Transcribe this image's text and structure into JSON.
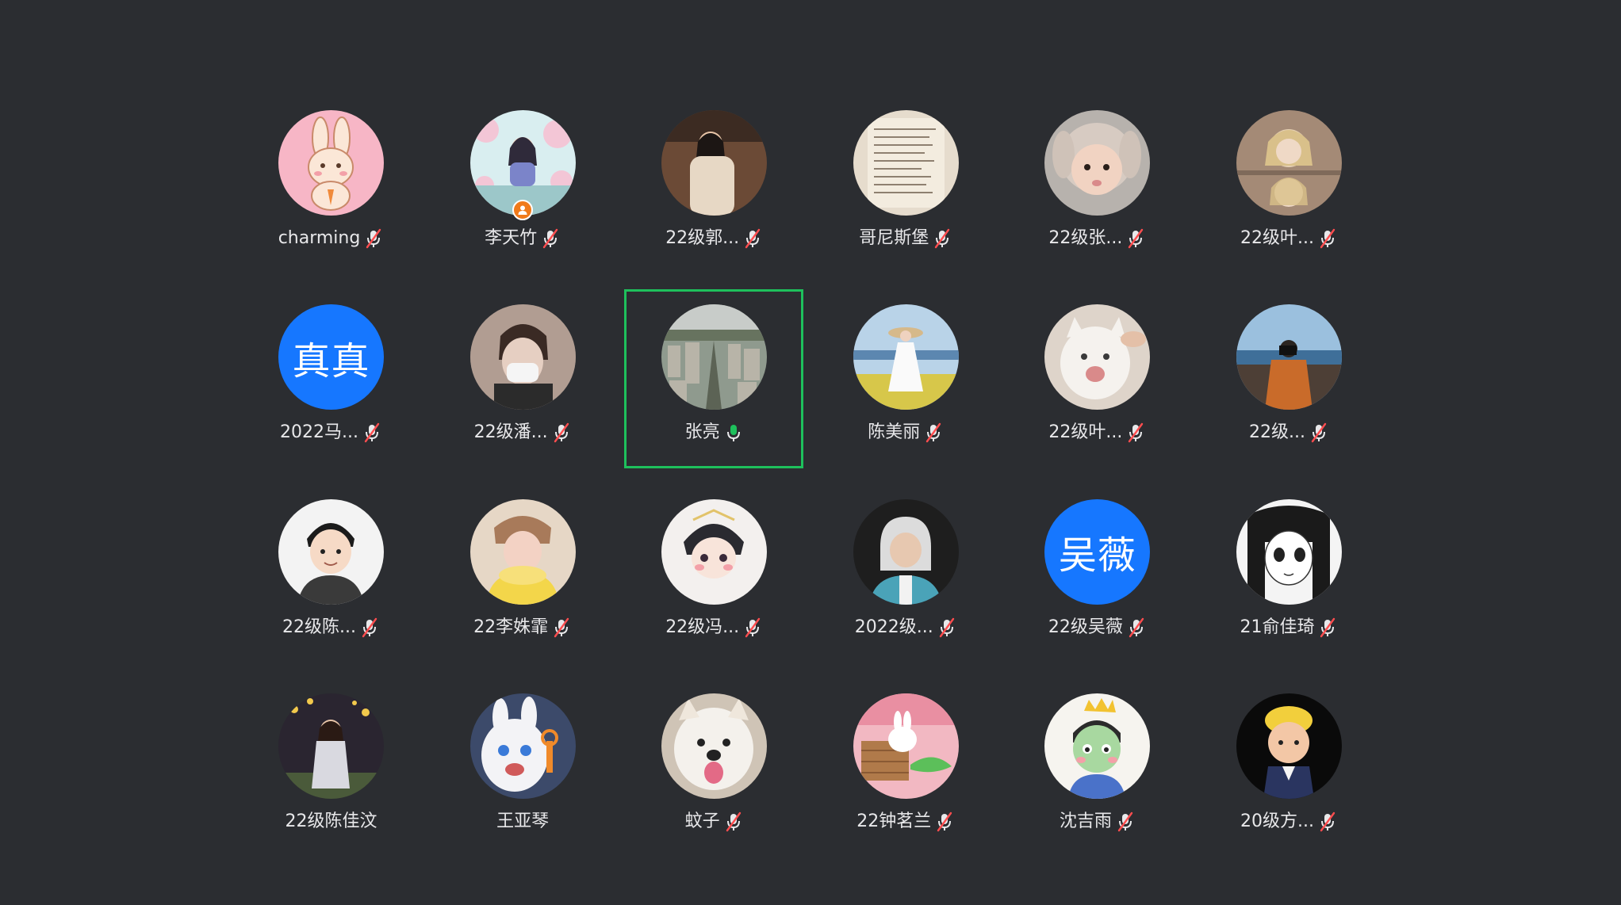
{
  "meeting": {
    "active_speaker": "张亮",
    "participants": [
      {
        "name": "charming",
        "avatar": "pink-bunny-cartoon",
        "mic": "muted"
      },
      {
        "name": "李天竹",
        "avatar": "illustrated-girl-cherry-blossoms",
        "mic": "muted",
        "badge": "host-badge-icon"
      },
      {
        "name": "22级郭...",
        "avatar": "photo-woman-indoor",
        "mic": "muted"
      },
      {
        "name": "哥尼斯堡",
        "avatar": "handwritten-paper",
        "mic": "muted"
      },
      {
        "name": "22级张...",
        "avatar": "baby-bunny-hat",
        "mic": "muted"
      },
      {
        "name": "22级叶...",
        "avatar": "blonde-girl-photo",
        "mic": "muted"
      },
      {
        "name": "2022马...",
        "avatar_text": "真真",
        "avatar_color": "#1677ff",
        "mic": "muted"
      },
      {
        "name": "22级潘...",
        "avatar": "masked-man-photo",
        "mic": "muted"
      },
      {
        "name": "张亮",
        "avatar": "city-aerial-photo",
        "mic": "speaking"
      },
      {
        "name": "陈美丽",
        "avatar": "woman-field-sea",
        "mic": "muted"
      },
      {
        "name": "22级叶...",
        "avatar": "white-cat-photo",
        "mic": "muted"
      },
      {
        "name": "22级...",
        "avatar": "man-camera-coast",
        "mic": "muted"
      },
      {
        "name": "22级陈...",
        "avatar": "cartoon-man-hoodie",
        "mic": "muted"
      },
      {
        "name": "22李姝霏",
        "avatar": "girl-yellow-scarf",
        "mic": "muted"
      },
      {
        "name": "22级冯...",
        "avatar": "anime-boy-cheeks",
        "mic": "muted"
      },
      {
        "name": "2022级...",
        "avatar": "kid-hoodie-photo",
        "mic": "muted"
      },
      {
        "name": "22级吴薇",
        "avatar_text": "吴薇",
        "avatar_color": "#1677ff",
        "mic": "muted"
      },
      {
        "name": "21俞佳琦",
        "avatar": "manga-girl-sketch",
        "mic": "muted"
      },
      {
        "name": "22级陈佳汶",
        "avatar": "woman-night-photo",
        "mic": "none"
      },
      {
        "name": "王亚琴",
        "avatar": "white-rabbit-cartoon",
        "mic": "none"
      },
      {
        "name": "蚊子",
        "avatar": "samoyed-dog-photo",
        "mic": "muted"
      },
      {
        "name": "22钟茗兰",
        "avatar": "rabbit-basket-photo",
        "mic": "muted"
      },
      {
        "name": "沈吉雨",
        "avatar": "crowned-boy-cartoon",
        "mic": "muted"
      },
      {
        "name": "20级方...",
        "avatar": "clay-boy-figure",
        "mic": "muted"
      }
    ]
  },
  "colors": {
    "background": "#2b2d31",
    "speaking_highlight": "#1ec05c",
    "muted_icon": "#ff4d4f",
    "text": "#e8e8ea"
  }
}
